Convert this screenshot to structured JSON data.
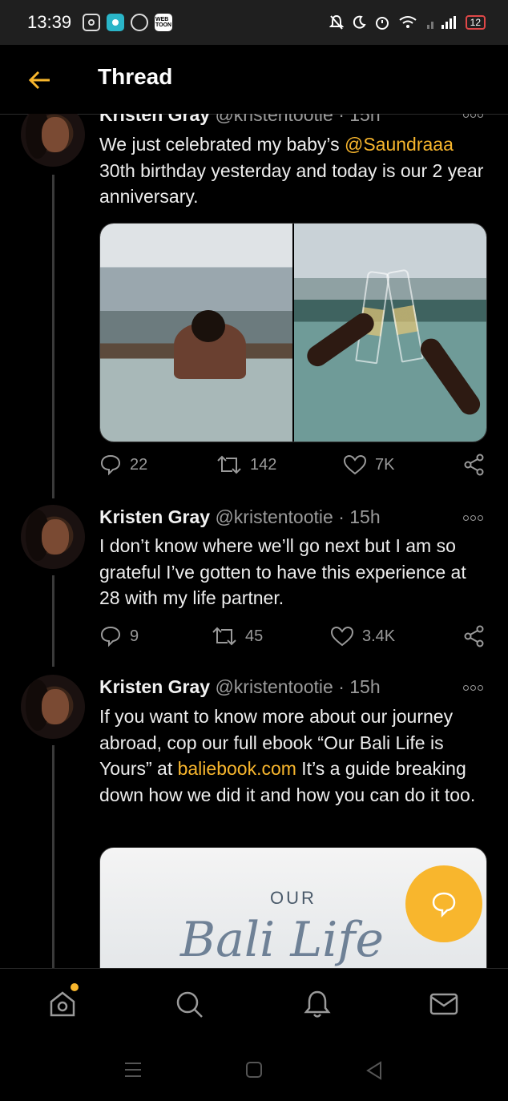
{
  "status_bar": {
    "time": "13:39",
    "webtoon_label": "WEB TOON",
    "battery": "12",
    "colors": {
      "battery_outline": "#e04848",
      "teal_app": "#2ab5c8"
    },
    "icons": [
      "instagram-icon",
      "app-icon",
      "whatsapp-icon",
      "webtoon-icon",
      "mute-icon",
      "moon-icon",
      "alarm-icon",
      "wifi-icon",
      "signal-icon",
      "battery-icon"
    ]
  },
  "header": {
    "title": "Thread",
    "back_icon": "back-arrow-icon"
  },
  "accent_color": "#f8b62d",
  "tweets": [
    {
      "name": "Kristen Gray",
      "handle": "@kristentootie",
      "dot": "·",
      "time": "15h",
      "text_before": "We just celebrated my baby’s ",
      "mention": "@Saundraaa",
      "text_after": " 30th birthday yesterday and today is our 2 year anniversary.",
      "media": [
        "hot-tub-ocean-view-photo",
        "champagne-toast-photo"
      ],
      "replies": "22",
      "retweets": "142",
      "likes": "7K"
    },
    {
      "name": "Kristen Gray",
      "handle": "@kristentootie",
      "dot": "·",
      "time": "15h",
      "text": "I don’t know where we’ll go next but I am so grateful I’ve gotten to have this experience at 28 with my life partner.",
      "replies": "9",
      "retweets": "45",
      "likes": "3.4K"
    },
    {
      "name": "Kristen Gray",
      "handle": "@kristentootie",
      "dot": "·",
      "time": "15h",
      "text_before": "If you want to know more about our journey abroad, cop our full ebook “Our Bali Life is Yours” at ",
      "link": "baliebook.com",
      "text_after": " It’s a guide breaking down how we did it and how you can do it too.",
      "card": {
        "line1": "OUR",
        "line2": "Bali Life"
      }
    }
  ],
  "bottom_nav": [
    "home-icon",
    "search-icon",
    "notifications-icon",
    "messages-icon"
  ],
  "system_nav": [
    "recents-button",
    "home-button",
    "back-button"
  ]
}
